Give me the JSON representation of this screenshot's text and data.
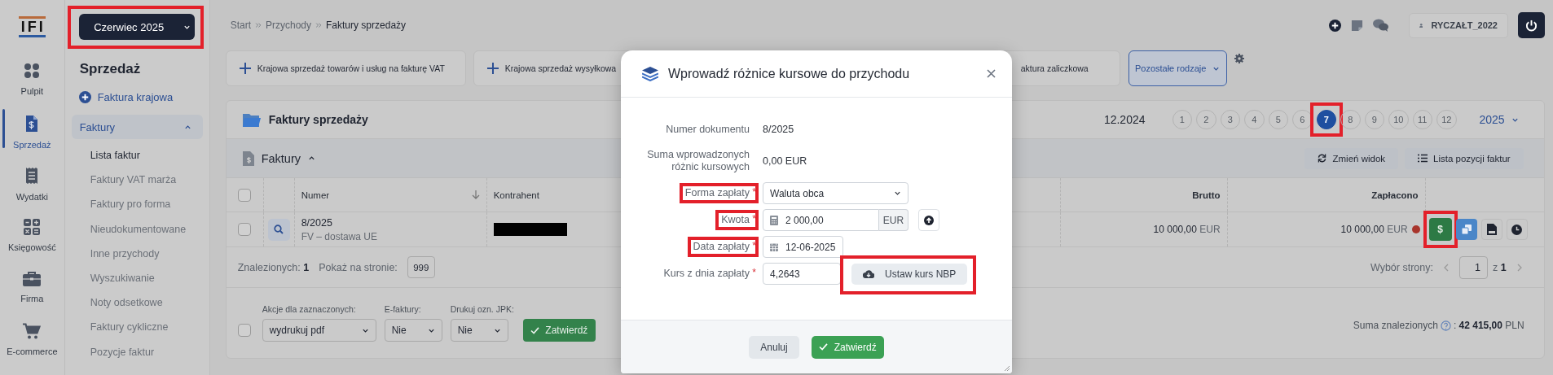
{
  "rail": {
    "logo": "IFI",
    "items": [
      {
        "label": "Pulpit",
        "kind": "dashboard",
        "selected": false
      },
      {
        "label": "Sprzedaż",
        "kind": "invoice",
        "selected": true
      },
      {
        "label": "Wydatki",
        "kind": "receipt",
        "selected": false
      },
      {
        "label": "Księgowość",
        "kind": "calculator",
        "selected": false
      },
      {
        "label": "Firma",
        "kind": "briefcase",
        "selected": false
      },
      {
        "label": "E-commerce",
        "kind": "cart",
        "selected": false
      }
    ]
  },
  "period_button": {
    "label": "Czerwiec 2025",
    "highlighted": true
  },
  "sidebar": {
    "title": "Sprzedaż",
    "new_link": "Faktura krajowa",
    "group": {
      "label": "Faktury",
      "expanded": true,
      "children": [
        {
          "label": "Lista faktur",
          "selected": true
        },
        {
          "label": "Faktury VAT marża",
          "selected": false
        },
        {
          "label": "Faktury pro forma",
          "selected": false
        },
        {
          "label": "Nieudokumentowane",
          "selected": false
        },
        {
          "label": "Inne przychody",
          "selected": false
        },
        {
          "label": "Wyszukiwanie",
          "selected": false
        },
        {
          "label": "Noty odsetkowe",
          "selected": false
        },
        {
          "label": "Faktury cykliczne",
          "selected": false
        },
        {
          "label": "Pozycje faktur",
          "selected": false
        }
      ]
    }
  },
  "breadcrumb": [
    "Start",
    "Przychody",
    "Faktury sprzedaży"
  ],
  "user": "RYCZAŁT_2022",
  "quick_add": [
    {
      "label": "Krajowa sprzedaż towarów i usług na fakturę VAT",
      "kind": "add"
    },
    {
      "label": "Krajowa sprzedaż wysyłkowa",
      "kind": "add"
    },
    {
      "label": "aktura zaliczkowa",
      "kind": "partial"
    }
  ],
  "other_types": "Pozostałe rodzaje",
  "panel": {
    "title": "Faktury sprzedaży",
    "period": "12.2024",
    "year": "2025",
    "months": [
      {
        "label": "1",
        "selected": false,
        "highlighted": false
      },
      {
        "label": "2",
        "selected": false,
        "highlighted": false
      },
      {
        "label": "3",
        "selected": false,
        "highlighted": false
      },
      {
        "label": "4",
        "selected": false,
        "highlighted": false
      },
      {
        "label": "5",
        "selected": false,
        "highlighted": false
      },
      {
        "label": "6",
        "selected": false,
        "highlighted": false
      },
      {
        "label": "7",
        "selected": true,
        "highlighted": true
      },
      {
        "label": "8",
        "selected": false,
        "highlighted": false
      },
      {
        "label": "9",
        "selected": false,
        "highlighted": false
      },
      {
        "label": "10",
        "selected": false,
        "highlighted": false
      },
      {
        "label": "11",
        "selected": false,
        "highlighted": false
      },
      {
        "label": "12",
        "selected": false,
        "highlighted": false
      }
    ]
  },
  "invoices": {
    "title": "Faktury",
    "expanded": true,
    "all_checked": false,
    "buttons": [
      {
        "label": "Zmień widok",
        "kind": "refresh"
      },
      {
        "label": "Lista pozycji faktur",
        "kind": "list"
      }
    ],
    "columns": [
      "Numer",
      "Kontrahent",
      "Brutto",
      "Zapłacono"
    ],
    "rows": [
      {
        "checked": false,
        "number": "8/2025",
        "type": "FV – dostawa UE",
        "gross": "10 000,00",
        "gross_currency": "EUR",
        "paid": "10 000,00",
        "paid_currency": "EUR",
        "color": "#a8352c",
        "actions": [
          {
            "kind": "payment",
            "label": "$",
            "highlighted": true
          },
          {
            "kind": "copy",
            "highlighted": false
          },
          {
            "kind": "pdf",
            "highlighted": false
          },
          {
            "kind": "history",
            "highlighted": false
          }
        ]
      }
    ],
    "found": "Znalezionych: **1**",
    "per_page_label": "Pokaż na stronie:",
    "per_page": "999",
    "page_label": "Wybór strony:",
    "page": "1",
    "page_count": "z **1**"
  },
  "bulk": {
    "checked": false,
    "fields": [
      {
        "label": "Akcje dla zaznaczonych:",
        "value": "wydrukuj pdf"
      },
      {
        "label": "E-faktury:",
        "value": "Nie"
      },
      {
        "label": "Drukuj ozn. JPK:",
        "value": "Nie"
      }
    ],
    "submit": "Zatwierdź",
    "total_label": "Suma znalezionych",
    "total": ": **42 415,00** PLN"
  },
  "modal": {
    "title": "Wprowadź różnice kursowe do przychodu",
    "fields": [
      {
        "kind": "static",
        "label": "Numer dokumentu",
        "value": "8/2025",
        "highlighted": false
      },
      {
        "kind": "static",
        "label": "Suma wprowadzonych różnic kursowych",
        "value": "0,00 EUR",
        "highlighted": false
      },
      {
        "kind": "select",
        "label": "Forma zapłaty",
        "required_mark": "*",
        "value": "Waluta obca",
        "highlighted": true
      },
      {
        "kind": "amount",
        "label": "Kwota",
        "required_mark": "*",
        "value": "2 000,00",
        "unit": "EUR",
        "highlighted": true
      },
      {
        "kind": "date",
        "label": "Data zapłaty",
        "required_mark": "*",
        "value": "12-06-2025",
        "highlighted": true
      },
      {
        "kind": "rate",
        "label": "Kurs z dnia zapłaty",
        "required_mark": "*",
        "value": "4,2643",
        "highlighted": false,
        "button": {
          "label": "Ustaw kurs NBP",
          "highlighted": true
        }
      }
    ],
    "cancel": "Anuluj",
    "confirm": "Zatwierdź"
  }
}
